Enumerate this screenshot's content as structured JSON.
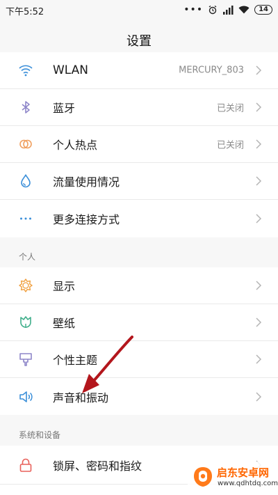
{
  "status_bar": {
    "time": "下午5:52",
    "battery": "14"
  },
  "header": {
    "title": "设置"
  },
  "sections": {
    "personal_label": "个人",
    "system_label": "系统和设备"
  },
  "rows": {
    "wlan": {
      "label": "WLAN",
      "value": "MERCURY_803",
      "icon": "wifi-icon"
    },
    "bluetooth": {
      "label": "蓝牙",
      "value": "已关闭",
      "icon": "bluetooth-icon"
    },
    "hotspot": {
      "label": "个人热点",
      "value": "已关闭",
      "icon": "hotspot-icon"
    },
    "data_usage": {
      "label": "流量使用情况",
      "icon": "water-drop-icon"
    },
    "more_connections": {
      "label": "更多连接方式",
      "icon": "more-dots-icon"
    },
    "display": {
      "label": "显示",
      "icon": "sun-icon"
    },
    "wallpaper": {
      "label": "壁纸",
      "icon": "tulip-icon"
    },
    "themes": {
      "label": "个性主题",
      "icon": "brush-icon"
    },
    "sound": {
      "label": "声音和振动",
      "icon": "speaker-icon"
    },
    "lock_screen": {
      "label": "锁屏、密码和指纹",
      "icon": "lock-icon"
    }
  },
  "watermark": {
    "title": "启东安卓网",
    "url": "www.qdhtdq.com"
  },
  "colors": {
    "accent_blue": "#3b8fd9",
    "bluetooth_purple": "#8e86c9",
    "hotspot_orange": "#f0a060",
    "display_orange": "#f0a040",
    "wallpaper_green": "#3fae8a",
    "theme_purple": "#8e86c9",
    "lock_red": "#e8605a",
    "annotation_arrow": "#b3161c",
    "watermark_orange": "#ff6600"
  }
}
